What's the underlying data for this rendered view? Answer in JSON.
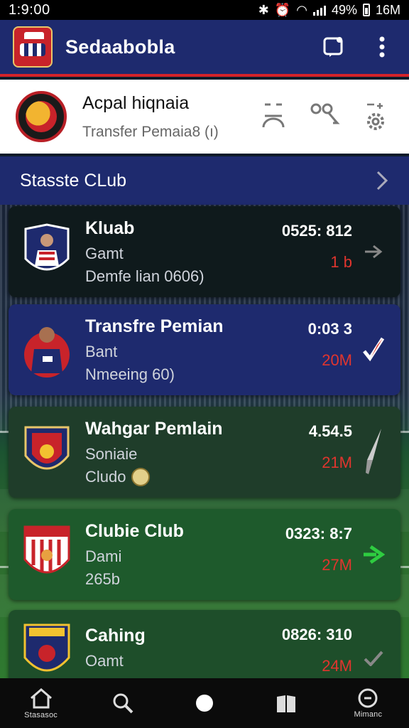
{
  "status_bar": {
    "time": "1:9:00",
    "battery": "49%",
    "data": "16M"
  },
  "app_bar": {
    "title": "Sedaabobla"
  },
  "profile": {
    "name": "Acpal hiqnaia",
    "subtitle": "Transfer Pemaia8 (ı)"
  },
  "section": {
    "label": "Stasste CLub"
  },
  "cards": [
    {
      "title": "Kluab",
      "line2": "Gamt",
      "line3": "Demfe lian 0606)",
      "value": "0525: 812",
      "amount": "1 b"
    },
    {
      "title": "Transfre Pemian",
      "line2": "Bant",
      "line3": "Nmeeing 60)",
      "value": "0:03 3",
      "amount": "20M"
    },
    {
      "title": "Wahgar Pemlain",
      "line2": "Soniaie",
      "line3": "Cludo",
      "value": "4.54.5",
      "amount": "21M"
    },
    {
      "title": "Clubie Club",
      "line2": "Dami",
      "line3": "265b",
      "value": "0323: 8:7",
      "amount": "27M"
    },
    {
      "title": "Cahing",
      "line2": "Oamt",
      "line3": "",
      "value": "0826: 310",
      "amount": "24M"
    }
  ],
  "bottom_nav": [
    {
      "label": "Stasasoc",
      "icon": "home-icon"
    },
    {
      "label": "",
      "icon": "search-icon"
    },
    {
      "label": "",
      "icon": "dot-icon"
    },
    {
      "label": "",
      "icon": "book-icon"
    },
    {
      "label": "Mimanc",
      "icon": "circle-icon"
    }
  ],
  "colors": {
    "primary": "#1e2a6e",
    "accent": "#d3232a",
    "green_action": "#2ecc40"
  }
}
